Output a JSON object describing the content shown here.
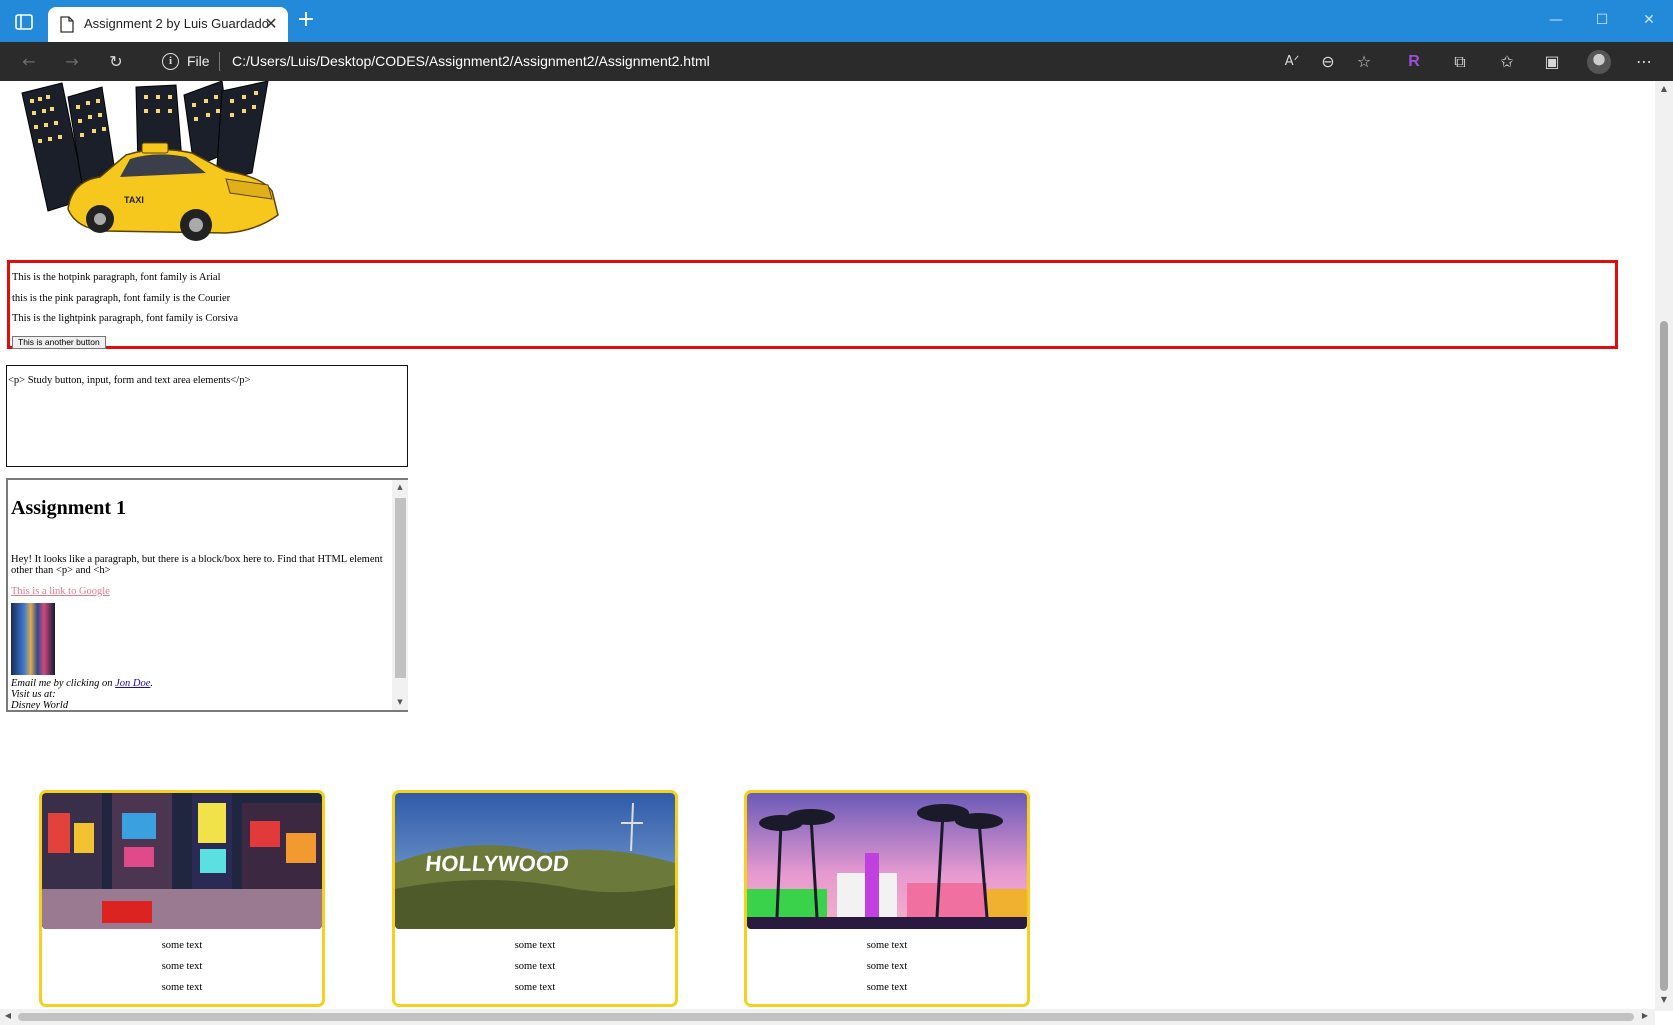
{
  "browser": {
    "tab_title": "Assignment 2 by Luis Guardado",
    "address_scheme_label": "File",
    "address_url": "C:/Users/Luis/Desktop/CODES/Assignment2/Assignment2/Assignment2.html",
    "accent_color": "#2389d9",
    "toolbar_icons": [
      "back-icon",
      "forward-icon",
      "refresh-icon",
      "read-aloud-icon",
      "zoom-out-icon",
      "add-favorite-icon",
      "extension-r-icon",
      "extensions-icon",
      "favorites-icon",
      "collections-icon",
      "profile-avatar",
      "more-icon"
    ]
  },
  "page": {
    "colored_paragraphs": [
      "This is the hotpink paragraph, font family is Arial",
      "this is the pink paragraph, font family is the Courier",
      "This is the lightpink paragraph, font family is Corsiva"
    ],
    "another_button_label": "This is another button",
    "textarea_value": "<p> Study button, input, form and text area elements</p>",
    "iframe": {
      "heading": "Assignment 1",
      "paragraph": "Hey! It looks like a paragraph, but there is a block/box here to. Find that HTML element other than <p> and <h>",
      "link_text": "This is a link to Google",
      "email_prefix": "Email me by clicking on ",
      "email_link": "Jon Doe",
      "email_suffix": ".",
      "visit_text": "Visit us at:",
      "partial_text": "Disney World"
    },
    "cards": [
      {
        "photo": "Times Square",
        "lines": [
          "some text",
          "some text",
          "some text"
        ]
      },
      {
        "photo": "Hollywood sign",
        "sign_text": "HOLLYWOOD",
        "lines": [
          "some text",
          "some text",
          "some text"
        ]
      },
      {
        "photo": "Miami palm trees",
        "lines": [
          "some text",
          "some text",
          "some text"
        ]
      }
    ],
    "card_border_color": "#f5d11d",
    "box_border_color": "#e00d0d"
  }
}
